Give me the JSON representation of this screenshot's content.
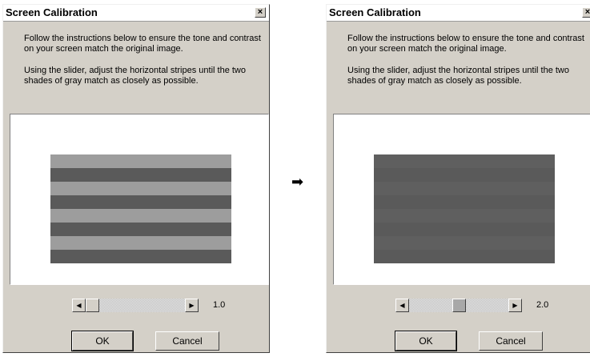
{
  "left_dialog": {
    "title": "Screen Calibration",
    "close_glyph": "×",
    "instruction_1": "Follow the instructions below to ensure the tone and contrast on your screen match the original image.",
    "instruction_2": "Using the slider, adjust the horizontal stripes until the two shades of gray match as closely as possible.",
    "slider": {
      "value_text": "1.0",
      "position_fraction": 0.0
    },
    "ok_label": "OK",
    "cancel_label": "Cancel"
  },
  "right_dialog": {
    "title": "Screen Calibration",
    "close_glyph": "×",
    "instruction_1": "Follow the instructions below to ensure the tone and contrast on your screen match the original image.",
    "instruction_2": "Using the slider, adjust the horizontal stripes until the two shades of gray match as closely as possible.",
    "slider": {
      "value_text": "2.0",
      "position_fraction": 0.5
    },
    "ok_label": "OK",
    "cancel_label": "Cancel"
  },
  "icons": {
    "arrow": "arrow-right-icon",
    "scroll_left": "scroll-left-icon",
    "scroll_right": "scroll-right-icon",
    "close": "close-icon"
  },
  "colors": {
    "dialog_bg": "#d4d0c8",
    "stripe_light": "#9d9d9d",
    "stripe_dark": "#5a5a5a"
  }
}
